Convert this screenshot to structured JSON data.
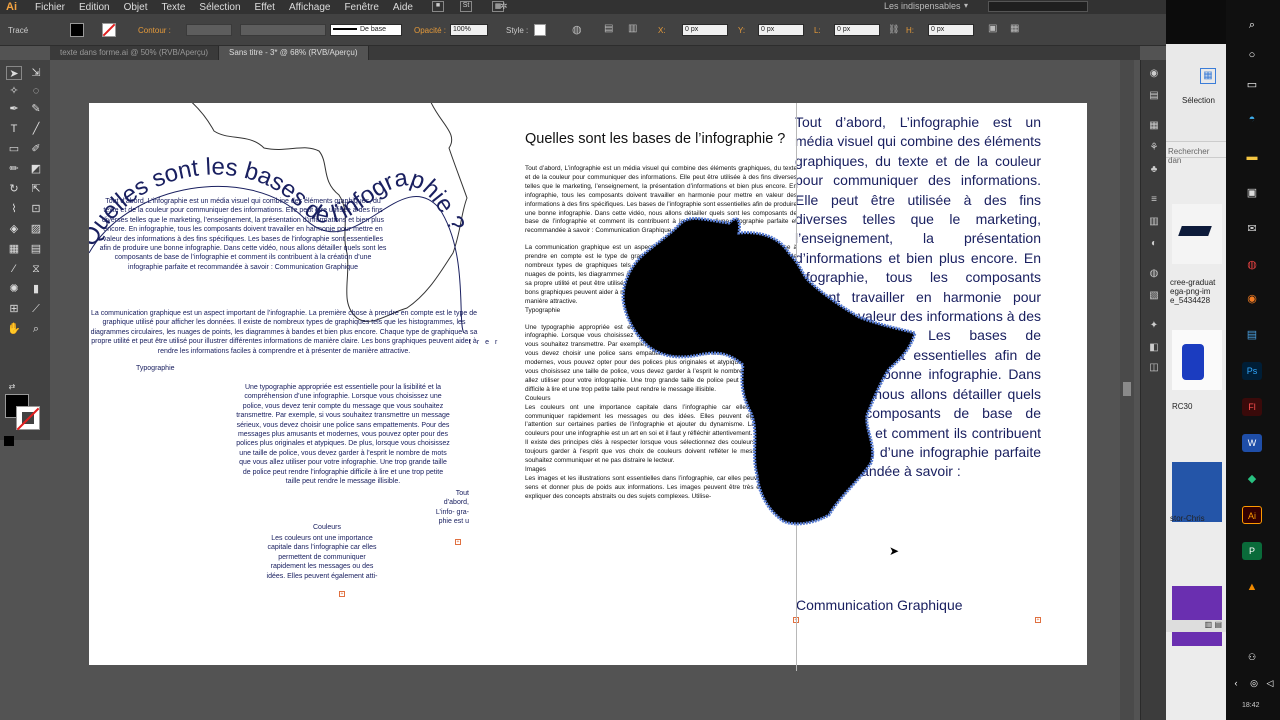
{
  "app": {
    "logo": "Ai",
    "menus": [
      "Fichier",
      "Edition",
      "Objet",
      "Texte",
      "Sélection",
      "Effet",
      "Affichage",
      "Fenêtre",
      "Aide"
    ],
    "workspace": "Les indispensables",
    "menu_icon_st": "St"
  },
  "control": {
    "trace_label": "Tracé",
    "contour_label": "Contour :",
    "stroke_style": "De base",
    "opacity_label": "Opacité :",
    "opacity_value": "100%",
    "style_label": "Style :",
    "x_label": "X:",
    "x_value": "0 px",
    "y_label": "Y:",
    "y_value": "0 px",
    "w_label": "L:",
    "w_value": "0 px",
    "h_label": "H:",
    "h_value": "0 px"
  },
  "tabs": [
    {
      "label": "texte dans forme.ai @ 50% (RVB/Aperçu)"
    },
    {
      "label": "Sans titre - 3* @ 68% (RVB/Aperçu)"
    }
  ],
  "artboard": {
    "curved_title": "Quelles sont les bases de l’infographie ?",
    "left_para1": "Tout d’abord, L’infographie est un média visuel qui combine des éléments graphiques, du texte et de la couleur pour communiquer des informations. Elle peut être utilisée à des fins diverses telles que le marketing, l’enseignement, la présentation d’informations et bien plus encore. En infographie, tous les composants doivent travailler en harmonie pour mettre en valeur des informations à des fins spécifiques. Les bases de l’infographie sont essentielles afin de produire une bonne infographie. Dans cette vidéo, nous allons détailler quels sont les composants de base de l’infographie et comment ils contribuent à la création d’une infographie parfaite et recommandée à savoir : Communication Graphique",
    "left_para2": "La communication graphique est un aspect important de l’infographie. La première chose à prendre en compte est le type de graphique utilisé pour afficher les données. Il existe de nombreux types de graphiques tels que les histogrammes, les diagrammes circulaires, les nuages de points, les diagrammes à bandes et bien plus encore. Chaque type de graphique a sa propre utilité et peut être utilisé pour illustrer différentes informations de manière claire. Les bons graphiques peuvent aider à rendre les informations faciles à comprendre et à présenter de manière attractive.",
    "left_stray": "t r e r",
    "typo_heading": "Typographie",
    "left_para3": "Une typographie appropriée est essentielle pour la lisibilité et la compréhension d’une infographie. Lorsque vous choisissez une police, vous devez tenir compte du message que vous souhaitez transmettre. Par exemple, si vous souhaitez transmettre un message sérieux, vous devez choisir une police sans empattements. Pour des messages plus amusants et modernes, vous pouvez opter pour des polices plus originales et atypiques. De plus, lorsque vous choisissez une taille de police, vous devez garder à l’esprit le nombre de mots que vous allez utiliser pour votre infographie. Une trop grande taille de police peut rendre l’infographie difficile à lire et une trop petite taille peut rendre le message illisible.",
    "couleurs_heading": "Couleurs",
    "left_para4": "Les couleurs ont une importance capitale dans l’infographie car elles permettent de communiquer rapidement les messages ou des idées. Elles peuvent également atti-",
    "small_block": "Tout d’abord, L’info- gra- phie est u",
    "mid_title": "Quelles sont les bases de l’infographie ?",
    "mid_para1": "Tout d’abord, L’infographie est un média visuel qui combine des éléments graphiques, du texte et de la couleur pour communiquer des informations. Elle peut être utilisée à des fins diverses telles que le marketing, l’enseignement, la présentation d’informations et bien plus encore. En infographie, tous les composants doivent travailler en harmonie pour mettre en valeur des informations à des fins spécifiques. Les bases de l’infographie sont essentielles afin de produire une bonne infographie. Dans cette vidéo, nous allons détailler quels sont les composants de base de l’infographie et comment ils contribuent à la création d’une infographie parfaite et recommandée à savoir : Communication Graphique",
    "mid_para2": "La communication graphique est un aspect important de l’infographie. La première chose à prendre en compte est le type de graphique utilisé pour afficher les données. Il existe de nombreux types de graphiques tels que les histogrammes, les diagrammes circulaires, les nuages de points, les diagrammes à bandes et bien plus encore. Chaque type de graphique a sa propre utilité et peut être utilisé pour illustrer différentes informations de manière claire. Les bons graphiques peuvent aider à rendre les informations faciles à comprendre et à présenter de manière attractive.",
    "mid_typo": "Typographie",
    "mid_para3": "Une typographie appropriée est essentielle pour la lisibilité et la compréhension d’une infographie. Lorsque vous choisissez une police, vous devez tenir compte du message que vous souhaitez transmettre. Par exemple, si vous souhaitez transmettre un message sérieux, vous devez choisir une police sans empattements. Pour des messages plus amusants et modernes, vous pouvez opter pour des polices plus originales et atypiques. De plus, lorsque vous choisissez une taille de police, vous devez garder à l’esprit le nombre de mots que vous allez utiliser pour votre infographie. Une trop grande taille de police peut rendre l’infographie difficile à lire et une trop petite taille peut rendre le message illisible.",
    "mid_couleurs": "Couleurs",
    "mid_para4": "Les couleurs ont une importance capitale dans l’infographie car elles permettent de communiquer rapidement les messages ou des idées. Elles peuvent également attirer l’attention sur certaines parties de l’infographie et ajouter du dynamisme. La sélection des couleurs pour une infographie est un art en soi et il faut y réfléchir attentivement.",
    "mid_para5": "Il existe des principes clés à respecter lorsque vous sélectionnez des couleurs. Vous devriez toujours garder à l’esprit que vos choix de couleurs doivent refléter le message que vous souhaitez communiquer et ne pas distraire le lecteur.",
    "mid_images": "Images",
    "mid_para6": "Les images et les illustrations sont essentielles dans l’infographie, car elles peuvent ajouter du sens et donner plus de poids aux informations. Les images peuvent être très efficaces pour expliquer des concepts abstraits ou des sujets complexes. Utilise-",
    "right_big": "Tout d’abord, L’infographie est un média visuel qui combine des éléments graphiques, du texte et de la couleur pour communiquer des informations. Elle peut être utilisée à des fins diverses telles que le marketing, l’enseignement, la présentation d’informations et bien plus encore. En infographie, tous les composants doivent travailler en harmonie pour mettre en valeur des informations à des fins spécifiques. Les bases de l’infographie sont essentielles afin de produire une bonne infographie. Dans cette vidéo, nous allons détailler quels sont les composants de base de l’infographie et comment ils contribuent à la création d’une infographie parfaite et recommandée à savoir :",
    "right_last": "Communication Graphique"
  },
  "explorer": {
    "ribbon_label": "Sélection",
    "search_placeholder": "Rechercher dan",
    "files": [
      {
        "name": "cree-graduat ega-png-im e_5434428"
      },
      {
        "name": "RC30"
      },
      {
        "name": "stor-Chris"
      }
    ]
  },
  "taskbar": {
    "clock": "18:42"
  },
  "colors": {
    "ui_dark": "#323232",
    "ui_mid": "#424242",
    "canvas": "#535353",
    "text_blue": "#1a2060",
    "africa_outline": "#5a7fd6",
    "ai_orange": "#f4a340"
  }
}
